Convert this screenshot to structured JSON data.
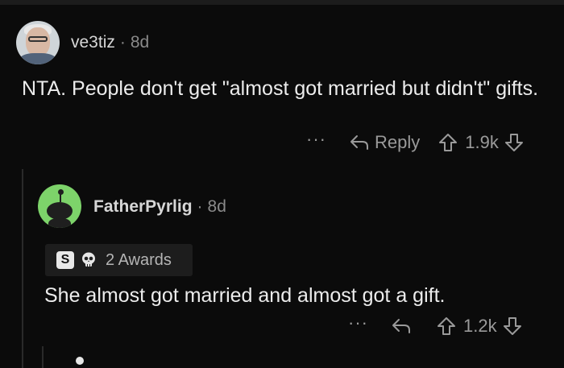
{
  "comments": [
    {
      "username": "ve3tiz",
      "separator": "·",
      "time": "8d",
      "text": "NTA.  People don't get \"almost got married but didn't\" gifts.",
      "more": "···",
      "reply_label": "Reply",
      "votes": "1.9k"
    },
    {
      "username": "FatherPyrlig",
      "separator": "·",
      "time": "8d",
      "awards_label": "2 Awards",
      "award_s": "S",
      "text": "She almost got married and almost got a gift.",
      "more": "···",
      "votes": "1.2k"
    }
  ],
  "colors": {
    "background": "#0b0b0b",
    "muted": "#9a9a9a",
    "snoo_green": "#7dd36a"
  }
}
